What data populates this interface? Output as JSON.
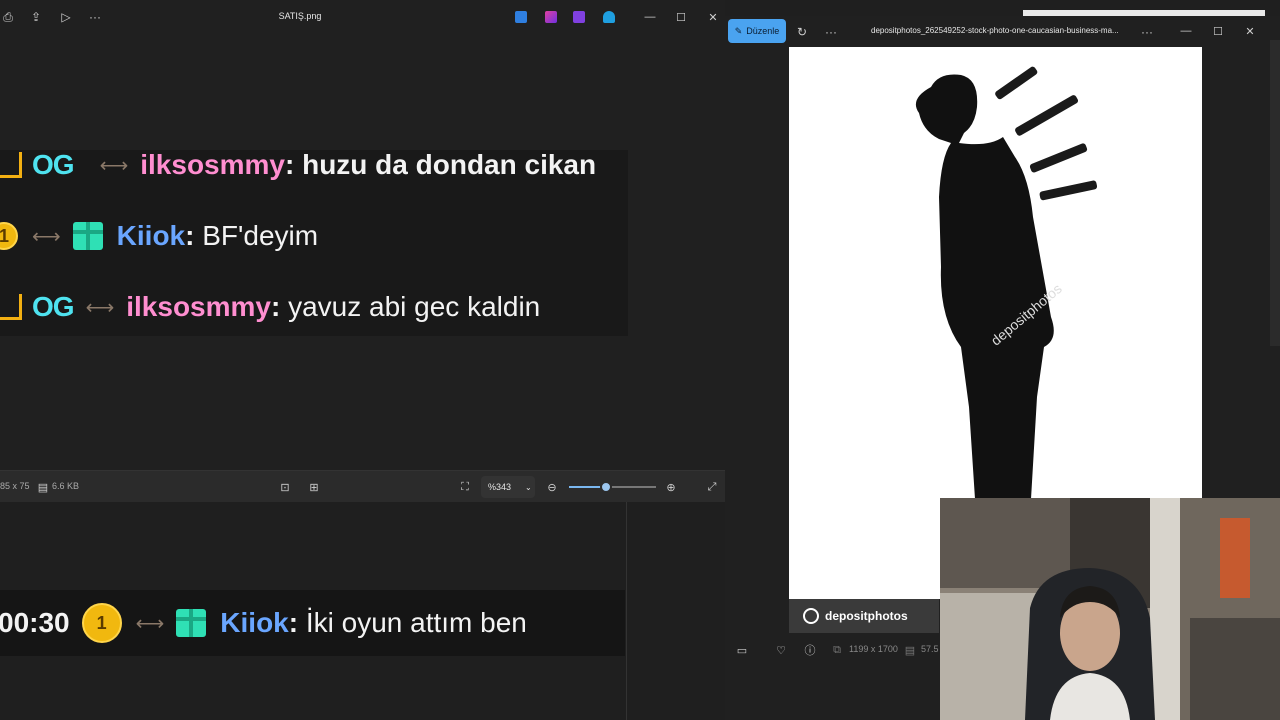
{
  "left_window": {
    "title": "SATIŞ.png",
    "chat_lines": [
      {
        "username": "ilksosmmy",
        "message": "huzu da dondan cikan"
      },
      {
        "username": "Kiiok",
        "message": "BF'deyim",
        "coin": "1"
      },
      {
        "username": "ilksosmmy",
        "message": "yavuz abi gec kaldin",
        "badge": "OG"
      }
    ],
    "status": {
      "dimensions": "85 x 75",
      "size": "6.6 KB",
      "zoom_value": "%343",
      "zoom_level": 0.43
    },
    "bottom_chat": {
      "time": "00:30",
      "coin": "1",
      "username": "Kiiok",
      "message": "İki oyun attım ben"
    }
  },
  "right_window": {
    "edit_label": "Düzenle",
    "title": "depositphotos_262549252-stock-photo-one-caucasian-business-ma...",
    "watermark": "depositphotos",
    "status": {
      "dimensions": "1199 x 1700",
      "size": "57.5"
    }
  },
  "colors": {
    "accent": "#4aa3f0",
    "coin": "#f1b80f",
    "gift": "#2fe0b5",
    "user_blue": "#6aa6ff",
    "user_pink": "#ff8ed0"
  }
}
